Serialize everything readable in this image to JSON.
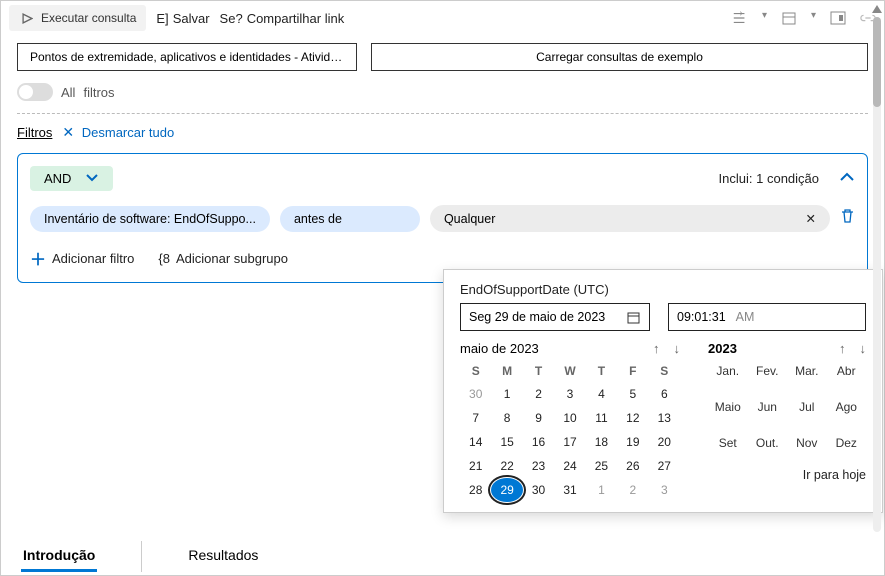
{
  "topbar": {
    "run": "Executar consulta",
    "save_prefix": "E]",
    "save": "Salvar",
    "share_prefix": "Se?",
    "share": "Compartilhar link"
  },
  "buttons": {
    "breadcrumb": "Pontos de extremidade, aplicativos e identidades - Atividade.",
    "load_examples": "Carregar consultas de exemplo"
  },
  "toggle": {
    "all": "All",
    "filters": "filtros"
  },
  "filters": {
    "label": "Filtros",
    "clear": "Desmarcar tudo"
  },
  "panel": {
    "and": "AND",
    "includes": "Inclui: 1 condição",
    "pill_field": "Inventário de software: EndOfSuppo...",
    "pill_op": "antes de",
    "pill_val": "Qualquer",
    "add_filter": "Adicionar filtro",
    "add_subgroup_prefix": "{8",
    "add_subgroup": "Adicionar subgrupo"
  },
  "popup": {
    "title": "EndOfSupportDate (UTC)",
    "date": "Seg 29 de maio de 2023",
    "time": "09:01:31",
    "ampm": "AM",
    "month": "maio de 2023",
    "year": "2023",
    "dow": [
      "S",
      "M",
      "T",
      "W",
      "T",
      "F",
      "S"
    ],
    "weeks": [
      [
        {
          "d": "30",
          "g": 1
        },
        {
          "d": "1"
        },
        {
          "d": "2"
        },
        {
          "d": "3"
        },
        {
          "d": "4"
        },
        {
          "d": "5"
        },
        {
          "d": "6"
        }
      ],
      [
        {
          "d": "7"
        },
        {
          "d": "8"
        },
        {
          "d": "9"
        },
        {
          "d": "10"
        },
        {
          "d": "11"
        },
        {
          "d": "12"
        },
        {
          "d": "13"
        }
      ],
      [
        {
          "d": "14"
        },
        {
          "d": "15"
        },
        {
          "d": "16"
        },
        {
          "d": "17"
        },
        {
          "d": "18"
        },
        {
          "d": "19"
        },
        {
          "d": "20"
        }
      ],
      [
        {
          "d": "21"
        },
        {
          "d": "22"
        },
        {
          "d": "23"
        },
        {
          "d": "24"
        },
        {
          "d": "25"
        },
        {
          "d": "26"
        },
        {
          "d": "27"
        }
      ],
      [
        {
          "d": "28"
        },
        {
          "d": "29",
          "sel": 1
        },
        {
          "d": "30"
        },
        {
          "d": "31"
        },
        {
          "d": "1",
          "g": 1
        },
        {
          "d": "2",
          "g": 1
        },
        {
          "d": "3",
          "g": 1
        }
      ]
    ],
    "months": [
      "Jan.",
      "Fev.",
      "Mar.",
      "Abr",
      "Maio",
      "Jun",
      "Jul",
      "Ago",
      "Set",
      "Out.",
      "Nov",
      "Dez"
    ],
    "today": "Ir para hoje"
  },
  "tabs": {
    "intro": "Introdução",
    "results": "Resultados"
  }
}
